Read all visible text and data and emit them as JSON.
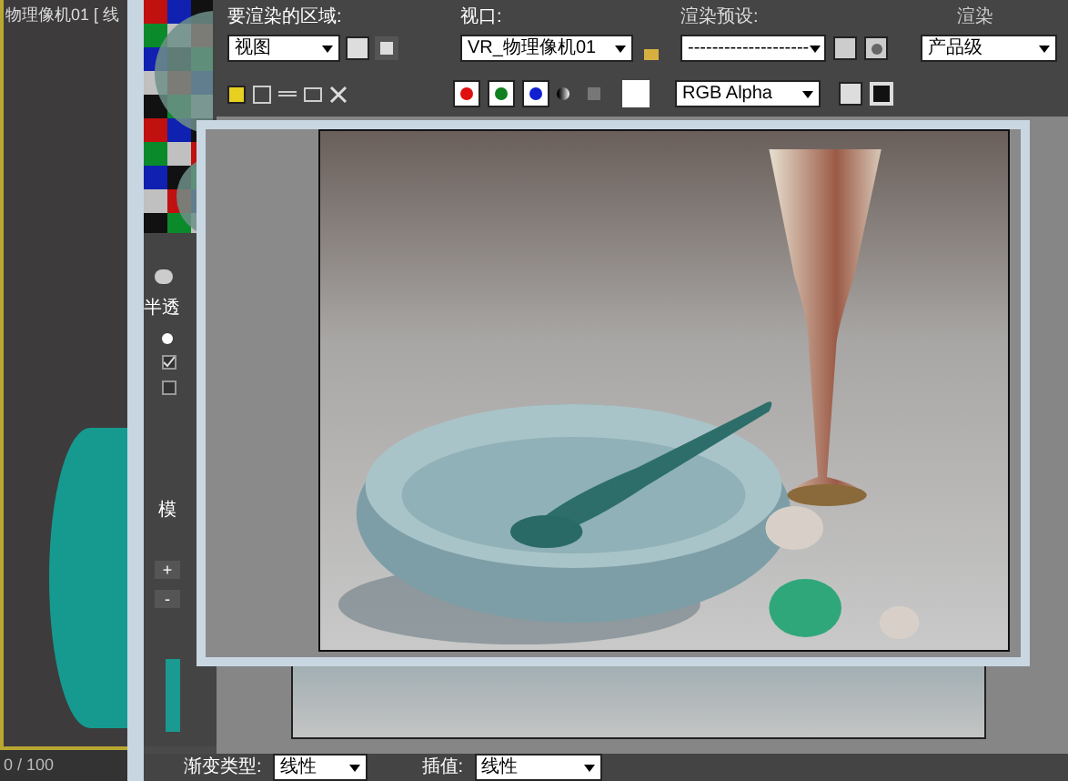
{
  "viewport": {
    "label": "物理像机01 [ 线",
    "frame_counter": "0 / 100"
  },
  "material_panel": {
    "section_label": "半透",
    "blur_label": "模",
    "plus": "+",
    "minus": "-",
    "options": [
      {
        "kind": "radio",
        "checked": true
      },
      {
        "kind": "checkbox",
        "checked": true
      },
      {
        "kind": "checkbox",
        "checked": false
      }
    ],
    "gradient_type_label": "渐变类型:",
    "gradient_type": "线性",
    "interpolation_label": "插值:",
    "interpolation": "线性"
  },
  "render_toolbar": {
    "area_label": "要渲染的区域:",
    "area_value": "视图",
    "viewport_label": "视口:",
    "viewport_value": "VR_物理像机01",
    "preset_label": "渲染预设:",
    "preset_value": "--------------------",
    "render_label": "渲染",
    "render_value": "产品级",
    "channel_value": "RGB Alpha",
    "color_channels": [
      {
        "color": "#e01010"
      },
      {
        "color": "#108020"
      },
      {
        "color": "#1020d0"
      }
    ]
  }
}
